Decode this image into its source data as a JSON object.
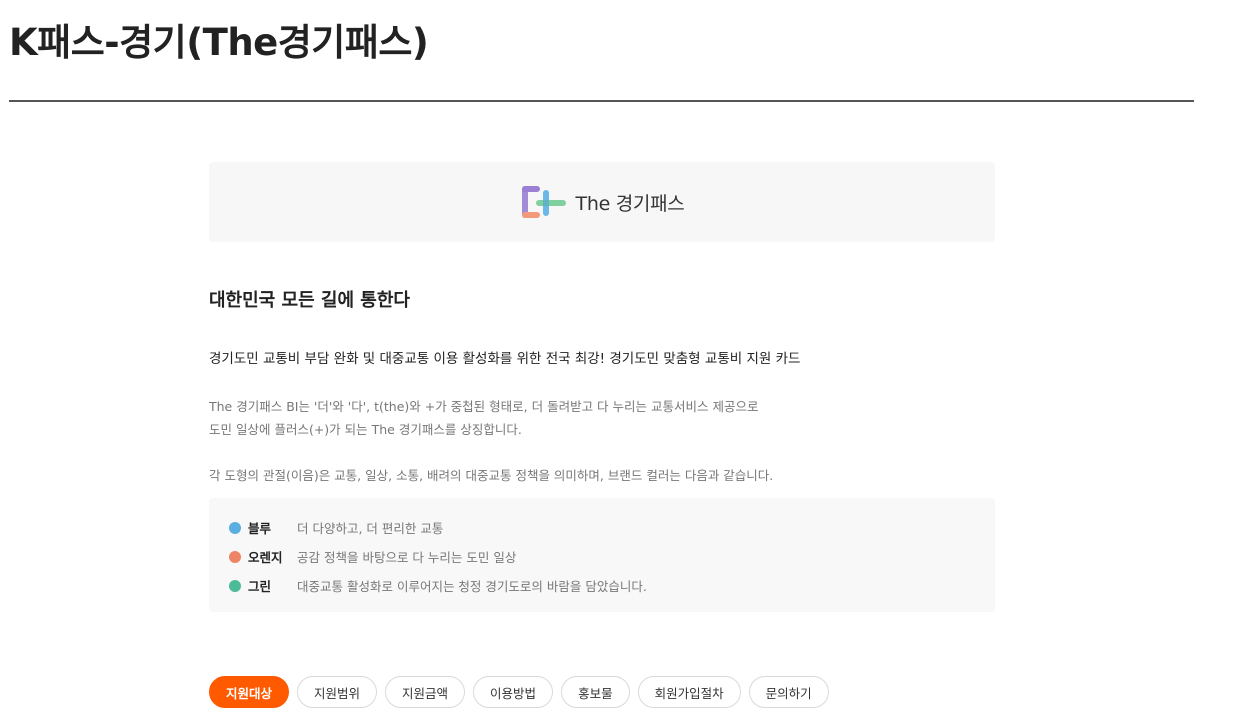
{
  "page": {
    "title": "K패스-경기(The경기패스)"
  },
  "logo": {
    "text": "The 경기패스",
    "colors": {
      "purple": "#9b7fd4",
      "blue": "#6ab7e8",
      "orange": "#f29a7a",
      "green": "#7fcf9f"
    }
  },
  "intro": {
    "headline": "대한민국 모든 길에 통한다",
    "lead": "경기도민 교통비 부담 완화 및 대중교통 이용 활성화를 위한 전국 최강! 경기도민 맞춤형 교통비 지원 카드",
    "desc_line1": "The 경기패스 BI는 '더'와 '다', t(the)와 +가 중첩된 형태로, 더 돌려받고 다 누리는 교통서비스 제공으로",
    "desc_line2": "도민 일상에 플러스(+)가 되는 The 경기패스를 상징합니다.",
    "desc_line3": "각 도형의 관절(이음)은 교통, 일상, 소통, 배려의 대중교통 정책을 의미하며, 브랜드 컬러는 다음과 같습니다."
  },
  "brand_colors": [
    {
      "name": "블루",
      "desc": "더 다양하고, 더 편리한 교통",
      "color": "#5aaee0"
    },
    {
      "name": "오렌지",
      "desc": "공감 정책을 바탕으로 다 누리는 도민 일상",
      "color": "#ee8466"
    },
    {
      "name": "그린",
      "desc": "대중교통 활성화로 이루어지는 청정 경기도로의 바람을 담았습니다.",
      "color": "#4dbb98"
    }
  ],
  "tabs": [
    {
      "label": "지원대상",
      "active": true
    },
    {
      "label": "지원범위",
      "active": false
    },
    {
      "label": "지원금액",
      "active": false
    },
    {
      "label": "이용방법",
      "active": false
    },
    {
      "label": "홍보물",
      "active": false
    },
    {
      "label": "회원가입절차",
      "active": false
    },
    {
      "label": "문의하기",
      "active": false
    }
  ],
  "accent_color": "#ff5a00"
}
